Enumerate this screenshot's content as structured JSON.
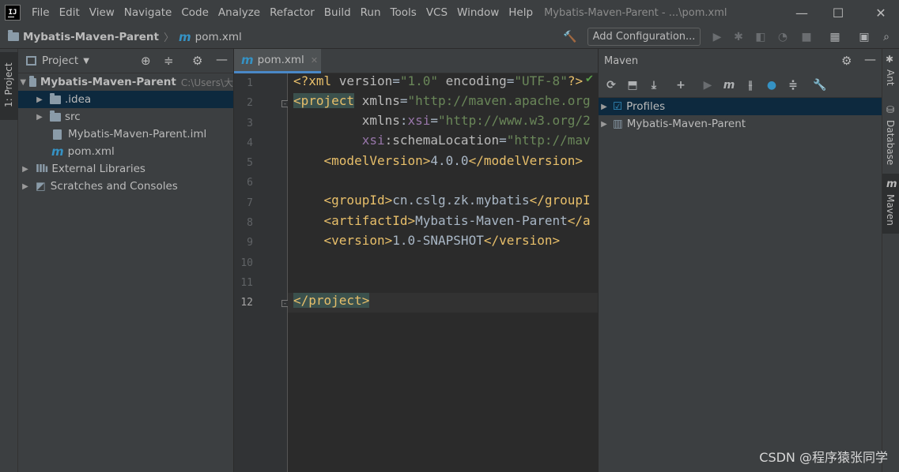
{
  "menu": [
    "File",
    "Edit",
    "View",
    "Navigate",
    "Code",
    "Analyze",
    "Refactor",
    "Build",
    "Run",
    "Tools",
    "VCS",
    "Window",
    "Help"
  ],
  "window_title": "Mybatis-Maven-Parent - ...\\pom.xml",
  "app_logo": "IJ",
  "breadcrumb": {
    "project": "Mybatis-Maven-Parent",
    "file": "pom.xml"
  },
  "toolbar": {
    "add_configuration": "Add Configuration..."
  },
  "left_stripe": {
    "project_tab": "1: Project"
  },
  "project_panel": {
    "title": "Project",
    "root": {
      "name": "Mybatis-Maven-Parent",
      "path": "C:\\Users\\大"
    },
    "items": [
      ".idea",
      "src",
      "Mybatis-Maven-Parent.iml",
      "pom.xml"
    ],
    "external": "External Libraries",
    "scratches": "Scratches and Consoles"
  },
  "editor": {
    "tab": "pom.xml",
    "line_numbers": [
      "1",
      "2",
      "3",
      "4",
      "5",
      "6",
      "7",
      "8",
      "9",
      "10",
      "11",
      "12"
    ],
    "lines": {
      "l1": {
        "a": "<?xml ",
        "b": "version",
        "c": "=",
        "d": "\"1.0\"",
        "e": " encoding",
        "f": "=",
        "g": "\"UTF-8\"",
        "h": "?>"
      },
      "l2": {
        "a": "<project",
        "b": " xmlns",
        "c": "=",
        "d": "\"http://maven.apache.org"
      },
      "l3": {
        "a": "         xmlns",
        "b": ":",
        "c": "xsi",
        "d": "=",
        "e": "\"http://www.w3.org/2"
      },
      "l4": {
        "a": "         xsi",
        "b": ":schemaLocation",
        "c": "=",
        "d": "\"http://mav"
      },
      "l5": {
        "a": "    <modelVersion>",
        "b": "4.0.0",
        "c": "</modelVersion>"
      },
      "l7": {
        "a": "    <groupId>",
        "b": "cn.cslg.zk.mybatis",
        "c": "</groupI"
      },
      "l8": {
        "a": "    <artifactId>",
        "b": "Mybatis-Maven-Parent",
        "c": "</a"
      },
      "l9": {
        "a": "    <version>",
        "b": "1.0-SNAPSHOT",
        "c": "</version>"
      },
      "l12": {
        "a": "</project>"
      }
    }
  },
  "maven_panel": {
    "title": "Maven",
    "tree": [
      "Profiles",
      "Mybatis-Maven-Parent"
    ]
  },
  "right_stripe": {
    "ant": "Ant",
    "database": "Database",
    "maven": "Maven"
  },
  "watermark": "CSDN @程序猿张同学"
}
